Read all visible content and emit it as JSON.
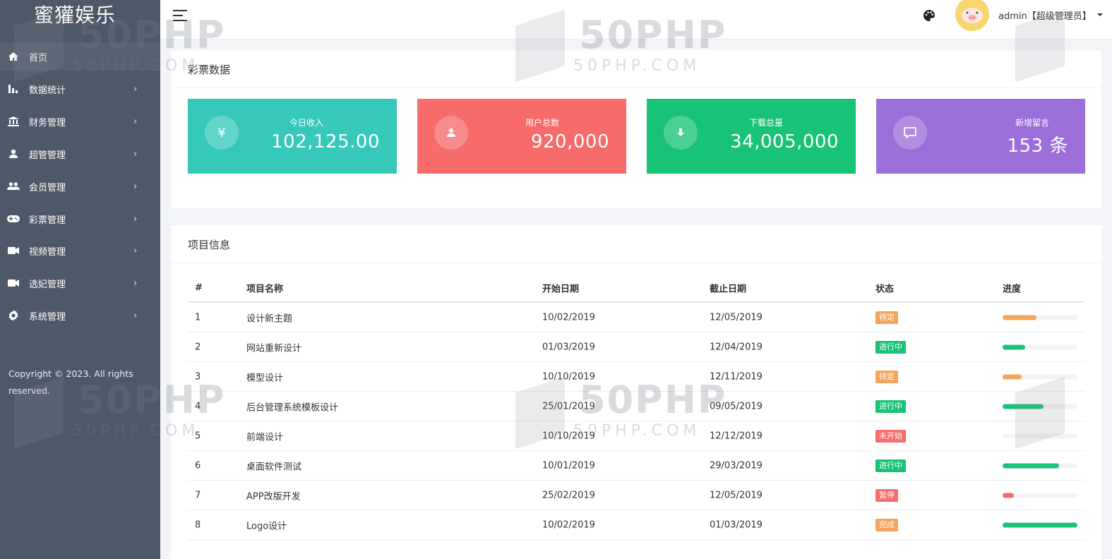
{
  "sidebar": {
    "brand": "蜜獾娱乐",
    "items": [
      {
        "label": "首页",
        "icon": "home-icon",
        "has_arrow": false
      },
      {
        "label": "数据统计",
        "icon": "bar-chart-icon",
        "has_arrow": true
      },
      {
        "label": "财务管理",
        "icon": "bank-icon",
        "has_arrow": true
      },
      {
        "label": "超管管理",
        "icon": "user-icon",
        "has_arrow": true
      },
      {
        "label": "会员管理",
        "icon": "users-icon",
        "has_arrow": true
      },
      {
        "label": "彩票管理",
        "icon": "gamepad-icon",
        "has_arrow": true
      },
      {
        "label": "视频管理",
        "icon": "video-camera-icon",
        "has_arrow": true
      },
      {
        "label": "选妃管理",
        "icon": "video-camera-icon",
        "has_arrow": true
      },
      {
        "label": "系统管理",
        "icon": "gear-icon",
        "has_arrow": true
      }
    ],
    "arrow": "›",
    "copyright": "Copyright © 2023. All rights reserved."
  },
  "header": {
    "user": "admin【超级管理员】"
  },
  "lottery": {
    "title": "彩票数据",
    "cards": [
      {
        "label": "今日收入",
        "value": "102,125.00",
        "icon": "¥",
        "color": "#36c8b9"
      },
      {
        "label": "用户总数",
        "value": "920,000",
        "icon": "user-icon",
        "color": "#f76b6b"
      },
      {
        "label": "下载总量",
        "value": "34,005,000",
        "icon": "download-icon",
        "color": "#19c375"
      },
      {
        "label": "新增留言",
        "value": "153 条",
        "icon": "comment-icon",
        "color": "#9a6fd9"
      }
    ]
  },
  "projects": {
    "title": "项目信息",
    "columns": [
      "#",
      "项目名称",
      "开始日期",
      "截止日期",
      "状态",
      "进度"
    ],
    "rows": [
      {
        "no": "1",
        "name": "设计新主题",
        "start": "10/02/2019",
        "end": "12/05/2019",
        "status": "待定",
        "status_color": "#f4a55c",
        "progress": 0.45,
        "bar_color": "#f4a55c"
      },
      {
        "no": "2",
        "name": "网站重新设计",
        "start": "01/03/2019",
        "end": "12/04/2019",
        "status": "进行中",
        "status_color": "#19c375",
        "progress": 0.3,
        "bar_color": "#19c375"
      },
      {
        "no": "3",
        "name": "模型设计",
        "start": "10/10/2019",
        "end": "12/11/2019",
        "status": "待定",
        "status_color": "#f4a55c",
        "progress": 0.25,
        "bar_color": "#f4a55c"
      },
      {
        "no": "4",
        "name": "后台管理系统模板设计",
        "start": "25/01/2019",
        "end": "09/05/2019",
        "status": "进行中",
        "status_color": "#19c375",
        "progress": 0.55,
        "bar_color": "#19c375"
      },
      {
        "no": "5",
        "name": "前端设计",
        "start": "10/10/2019",
        "end": "12/12/2019",
        "status": "未开始",
        "status_color": "#f76b6b",
        "progress": 0.0,
        "bar_color": "#f76b6b"
      },
      {
        "no": "6",
        "name": "桌面软件测试",
        "start": "10/01/2019",
        "end": "29/03/2019",
        "status": "进行中",
        "status_color": "#19c375",
        "progress": 0.75,
        "bar_color": "#19c375"
      },
      {
        "no": "7",
        "name": "APP改版开发",
        "start": "25/02/2019",
        "end": "12/05/2019",
        "status": "暂停",
        "status_color": "#f76b6b",
        "progress": 0.15,
        "bar_color": "#f76b6b"
      },
      {
        "no": "8",
        "name": "Logo设计",
        "start": "10/02/2019",
        "end": "01/03/2019",
        "status": "完成",
        "status_color": "#f4a55c",
        "progress": 1.0,
        "bar_color": "#19c375"
      }
    ]
  },
  "watermark": {
    "big": "50PHP",
    "small": "50PHP.COM"
  }
}
